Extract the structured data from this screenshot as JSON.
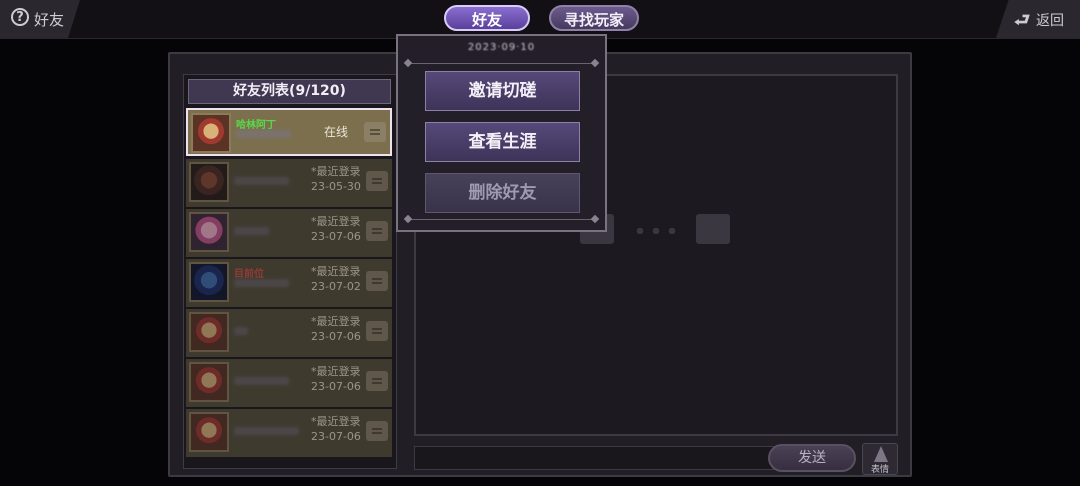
{
  "topbar": {
    "help_icon": "?",
    "help_label": "好友",
    "tabs": [
      {
        "label": "好友",
        "active": true
      },
      {
        "label": "寻找玩家",
        "active": false
      }
    ],
    "back_icon": "⮐",
    "back_label": "返回"
  },
  "friends": {
    "header": "好友列表(9/120)",
    "rows": [
      {
        "name": "哈林阿丁",
        "status": "在线",
        "selected": true,
        "avatar": "avatar-red"
      },
      {
        "name": "",
        "status": "*最近登录",
        "date": "23-05-30",
        "avatar": "avatar-dark"
      },
      {
        "name": "",
        "status": "*最近登录",
        "date": "23-07-06",
        "avatar": "avatar-pink"
      },
      {
        "name": "目前位",
        "status": "*最近登录",
        "date": "23-07-02",
        "avatar": "avatar-blue"
      },
      {
        "name": "",
        "status": "*最近登录",
        "date": "23-07-06",
        "avatar": "avatar-red"
      },
      {
        "name": "",
        "status": "*最近登录",
        "date": "23-07-06",
        "avatar": "avatar-red"
      },
      {
        "name": "",
        "status": "*最近登录",
        "date": "23-07-06",
        "avatar": "avatar-red"
      }
    ]
  },
  "popup": {
    "title": "2023·09·10",
    "buttons": [
      "邀请切磋",
      "查看生涯",
      "删除好友"
    ]
  },
  "chat": {
    "send_label": "发送",
    "emote_label": "表情",
    "input_value": ""
  },
  "colors": {
    "online_name": "#5ad84a",
    "accent_tab": "#8a6fd0",
    "highlight_name": "#d8504a"
  }
}
